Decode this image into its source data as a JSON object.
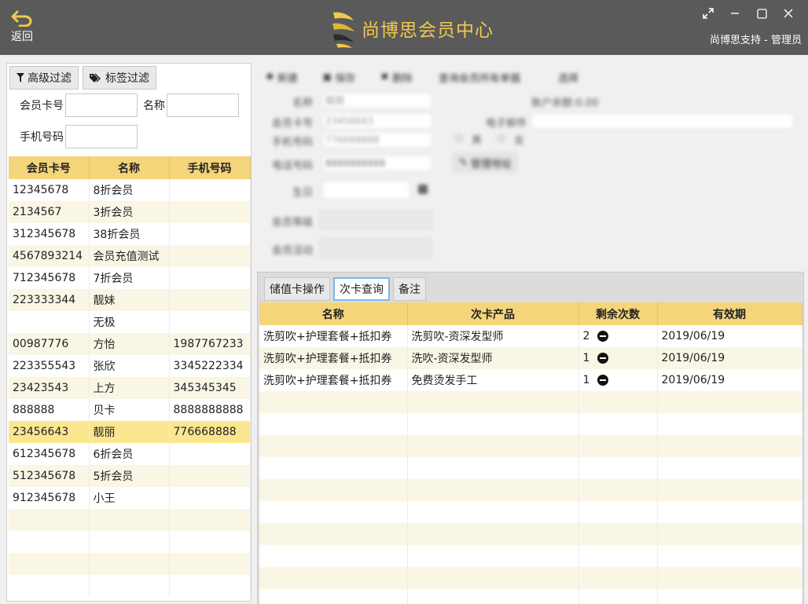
{
  "header": {
    "back_label": "返回",
    "title": "尚博思会员中心",
    "user": "尚博思支持 - 管理员",
    "accent": "#f2c94c"
  },
  "filters": {
    "advanced_label": "高级过滤",
    "tag_label": "标签过滤",
    "card_label": "会员卡号",
    "name_label": "名称",
    "phone_label": "手机号码",
    "card_value": "",
    "name_value": "",
    "phone_value": ""
  },
  "members": {
    "columns": [
      "会员卡号",
      "名称",
      "手机号码"
    ],
    "rows": [
      [
        "12345678",
        "8折会员",
        ""
      ],
      [
        "2134567",
        "3折会员",
        ""
      ],
      [
        "312345678",
        "38折会员",
        ""
      ],
      [
        "4567893214",
        "会员充值测试",
        ""
      ],
      [
        "712345678",
        "7折会员",
        ""
      ],
      [
        "223333344",
        "靓妹",
        ""
      ],
      [
        "",
        "无极",
        ""
      ],
      [
        "00987776",
        "方怡",
        "1987767233"
      ],
      [
        "223355543",
        "张欣",
        "3345222334"
      ],
      [
        "23423543",
        "上方",
        "345345345"
      ],
      [
        "888888",
        "贝卡",
        "8888888888"
      ],
      [
        "23456643",
        "靓丽",
        "776668888"
      ],
      [
        "612345678",
        "6折会员",
        ""
      ],
      [
        "512345678",
        "5折会员",
        ""
      ],
      [
        "912345678",
        "小王",
        ""
      ]
    ],
    "selected_index": 11
  },
  "toolbar": {
    "new_label": "新建",
    "save_label": "保存",
    "delete_label": "删除",
    "query_label": "查询会员所有单据",
    "select_label": "选择"
  },
  "form": {
    "name_label": "名称",
    "name_value": "靓丽",
    "card_label": "会员卡号",
    "card_value": "23456643",
    "phone_label": "手机号码",
    "phone_value": "776668888",
    "tel_label": "电话号码",
    "tel_value": "8888888888",
    "birthday_label": "生日",
    "level_label": "会员等级",
    "activity_label": "会员活动",
    "balance_label": "账户余额:0.00",
    "email_label": "电子邮件",
    "male_label": "男",
    "female_label": "女",
    "address_label": "管理地址"
  },
  "tabs": [
    {
      "label": "储值卡操作"
    },
    {
      "label": "次卡查询"
    },
    {
      "label": "备注"
    }
  ],
  "count_cards": {
    "columns": [
      "名称",
      "次卡产品",
      "剩余次数",
      "有效期"
    ],
    "rows": [
      [
        "洗剪吹+护理套餐+抵扣券",
        "洗剪吹-资深发型师",
        "2",
        "2019/06/19"
      ],
      [
        "洗剪吹+护理套餐+抵扣券",
        "洗吹-资深发型师",
        "1",
        "2019/06/19"
      ],
      [
        "洗剪吹+护理套餐+抵扣券",
        "免费烫发手工",
        "1",
        "2019/06/19"
      ]
    ]
  }
}
